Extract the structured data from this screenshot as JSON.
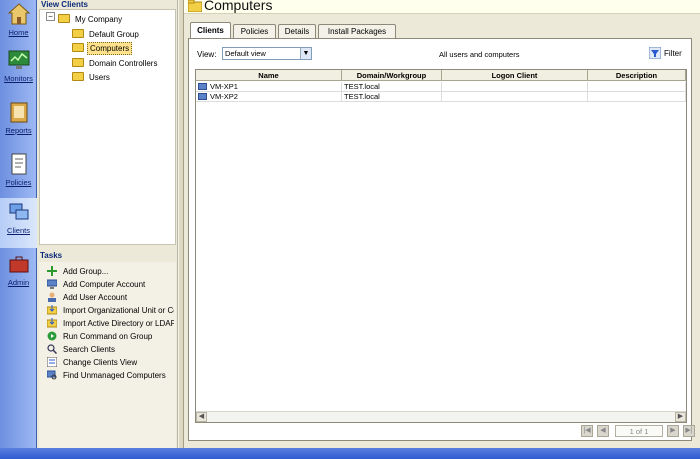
{
  "nav": {
    "items": [
      {
        "label": "Home",
        "icon": "home-icon"
      },
      {
        "label": "Monitors",
        "icon": "monitor-icon"
      },
      {
        "label": "Reports",
        "icon": "reports-icon"
      },
      {
        "label": "Policies",
        "icon": "policies-icon"
      },
      {
        "label": "Clients",
        "icon": "clients-icon"
      },
      {
        "label": "Admin",
        "icon": "admin-icon"
      }
    ],
    "active": "Clients"
  },
  "tree": {
    "title": "View Clients",
    "root": "My Company",
    "children": [
      "Default Group",
      "Computers",
      "Domain Controllers",
      "Users"
    ],
    "selected": "Computers"
  },
  "tasks": {
    "title": "Tasks",
    "items": [
      "Add Group...",
      "Add Computer Account",
      "Add User Account",
      "Import Organizational Unit or Cont",
      "Import Active Directory or LDAP U",
      "Run Command on Group",
      "Search Clients",
      "Change Clients View",
      "Find Unmanaged Computers"
    ]
  },
  "main": {
    "title": "Computers",
    "tabs": [
      "Clients",
      "Policies",
      "Details",
      "Install Packages"
    ],
    "active_tab": "Clients",
    "view_label": "View:",
    "view_value": "Default view",
    "scope_text": "All users and computers",
    "filter_label": "Filter",
    "columns": [
      "Name",
      "Domain/Workgroup",
      "Logon Client",
      "Description"
    ],
    "rows": [
      [
        "VM-XP1",
        "TEST.local",
        "",
        ""
      ],
      [
        "VM-XP2",
        "TEST.local",
        "",
        ""
      ]
    ],
    "pager": "1 of 1"
  },
  "colors": {
    "nav_blue": "#6d8fe0",
    "selection": "#ffe38c",
    "pane": "#ece9d8"
  }
}
